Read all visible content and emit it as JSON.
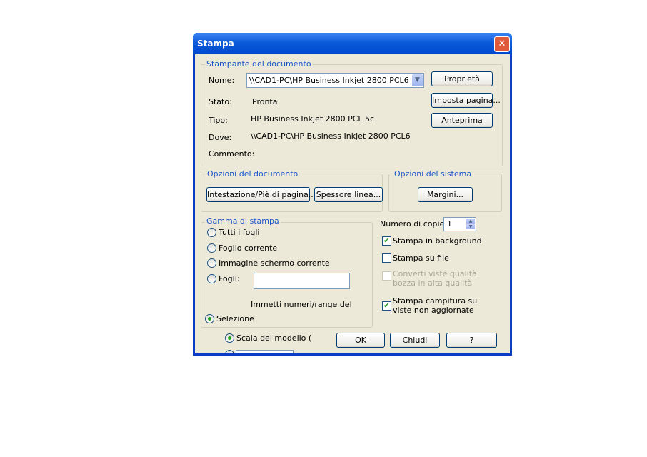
{
  "dialog": {
    "title": "Stampa",
    "close_glyph": "✕"
  },
  "printer_group": {
    "legend": "Stampante del documento",
    "name_label": "Nome:",
    "name_value": "\\\\CAD1-PC\\HP Business Inkjet 2800 PCL6",
    "status_label": "Stato:",
    "status_value": "Pronta",
    "type_label": "Tipo:",
    "type_value": "HP Business Inkjet 2800 PCL 5c",
    "where_label": "Dove:",
    "where_value": "\\\\CAD1-PC\\HP Business Inkjet 2800 PCL6",
    "comment_label": "Commento:",
    "properties_button": "Proprietà",
    "page_setup_button": "Imposta pagina...",
    "preview_button": "Anteprima"
  },
  "document_options": {
    "legend": "Opzioni del documento",
    "header_footer_button": "Intestazione/Piè di pagina...",
    "line_weight_button": "Spessore linea..."
  },
  "system_options": {
    "legend": "Opzioni del sistema",
    "margins_button": "Margini..."
  },
  "print_range": {
    "legend": "Gamma di stampa",
    "all_sheets": "Tutti i fogli",
    "current_sheet": "Foglio corrente",
    "current_screen": "Immagine schermo corrente",
    "sheets": "Fogli:",
    "sheets_value": "",
    "hint": "Immetti numeri/range del fogli",
    "selection": "Selezione",
    "model_scale": "Scala del modello ("
  },
  "options": {
    "copies_label": "Numero di copie:",
    "copies_value": "1",
    "background_print": "Stampa in background",
    "print_to_file": "Stampa su file",
    "convert_draft": "Converti viste qualità bozza in alta qualità",
    "print_hatch": "Stampa campitura su viste non aggiornate",
    "background_print_checked": true,
    "print_to_file_checked": false,
    "convert_draft_checked": false,
    "print_hatch_checked": true
  },
  "footer": {
    "ok_button": "OK",
    "close_button": "Chiudi",
    "help_button": "?"
  }
}
